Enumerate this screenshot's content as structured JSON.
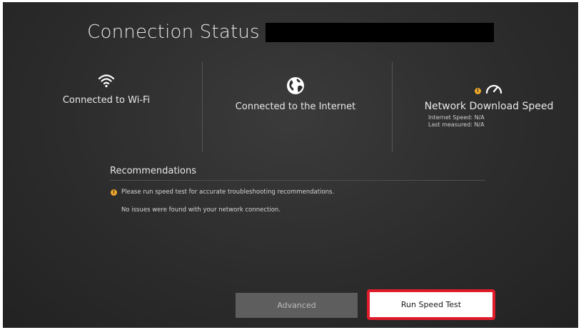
{
  "header": {
    "title": "Connection Status"
  },
  "status": {
    "wifi_label": "Connected to Wi-Fi",
    "internet_label": "Connected to the Internet",
    "speed_label": "Network Download Speed",
    "internet_speed": "Internet Speed: N/A",
    "last_measured": "Last measured: N/A"
  },
  "recommendations": {
    "title": "Recommendations",
    "items": [
      "Please run speed test for accurate troubleshooting recommendations.",
      "No issues were found with your network connection."
    ]
  },
  "buttons": {
    "advanced": "Advanced",
    "run_speed_test": "Run Speed Test"
  },
  "colors": {
    "warning": "#f0a82a",
    "highlight": "#e01b2a",
    "background": "#2c2c2c"
  },
  "icons": {
    "wifi": "wifi-icon",
    "internet": "globe-icon",
    "speed": "speedometer-icon",
    "warning": "warning-icon"
  }
}
